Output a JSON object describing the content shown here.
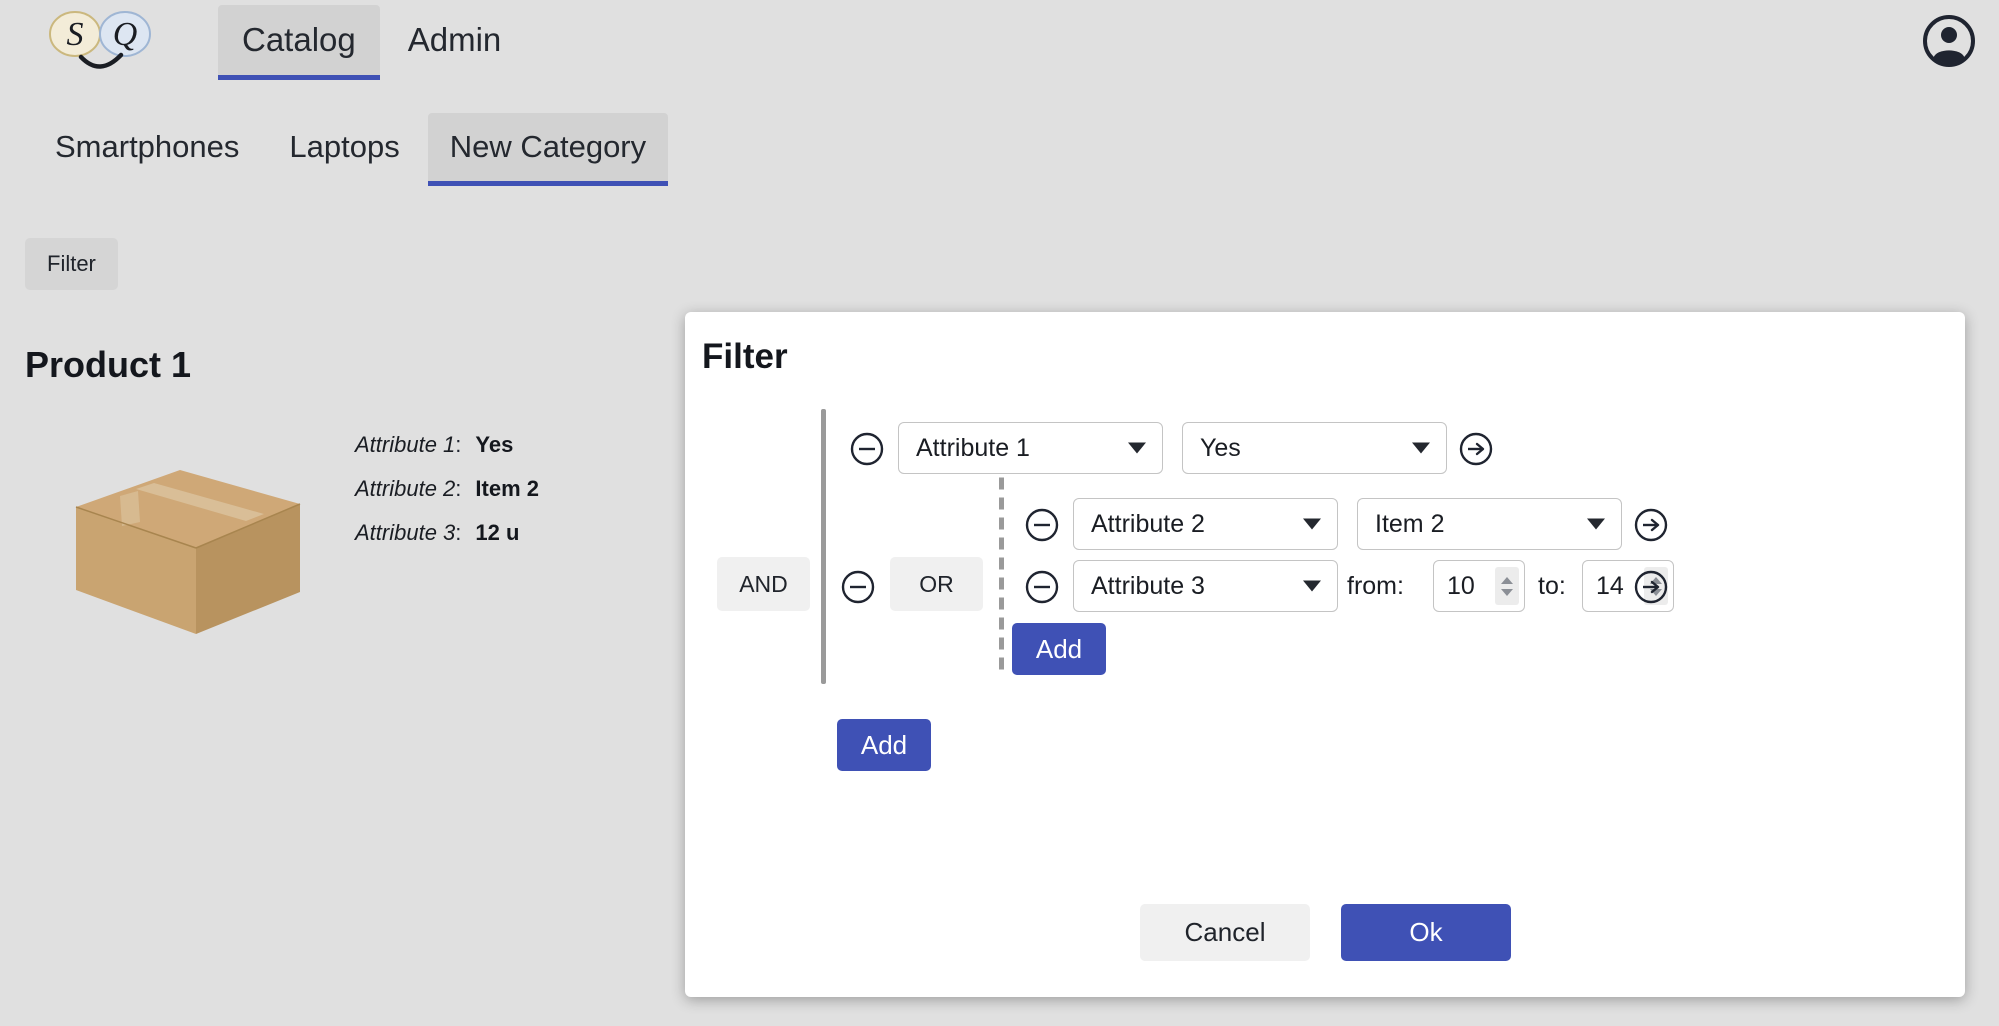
{
  "app": {
    "logo_letters": [
      "S",
      "Q"
    ],
    "accent_color": "#3f51b5",
    "background_color": "#e0e0e0",
    "dialog_background": "#ffffff"
  },
  "header": {
    "tabs": [
      {
        "label": "Catalog",
        "active": true
      },
      {
        "label": "Admin",
        "active": false
      }
    ],
    "account_icon": "account-circle-icon"
  },
  "category_tabs": [
    {
      "label": "Smartphones",
      "active": false
    },
    {
      "label": "Laptops",
      "active": false
    },
    {
      "label": "New Category",
      "active": true
    }
  ],
  "catalog": {
    "filter_button_label": "Filter",
    "product": {
      "title": "Product 1",
      "image": "cardboard-box",
      "attributes": [
        {
          "label": "Attribute 1",
          "separator": ":",
          "value": "Yes"
        },
        {
          "label": "Attribute 2",
          "separator": ":",
          "value": "Item 2"
        },
        {
          "label": "Attribute 3",
          "separator": ":",
          "value": "12 u"
        }
      ]
    }
  },
  "dialog": {
    "title": "Filter",
    "outer_group": {
      "operator_label": "AND",
      "add_label": "Add",
      "remove_icon": "minus-circle-icon"
    },
    "inner_group": {
      "operator_label": "OR",
      "add_label": "Add",
      "remove_icon": "minus-circle-icon"
    },
    "conditions": [
      {
        "attribute": "Attribute 1",
        "value_type": "select",
        "value": "Yes",
        "remove_icon": "minus-circle-icon",
        "goto_icon": "arrow-right-circle-icon"
      },
      {
        "attribute": "Attribute 2",
        "value_type": "select",
        "value": "Item 2",
        "remove_icon": "minus-circle-icon",
        "goto_icon": "arrow-right-circle-icon"
      },
      {
        "attribute": "Attribute 3",
        "value_type": "range",
        "from_label": "from:",
        "from_value": "10",
        "to_label": "to:",
        "to_value": "14",
        "remove_icon": "minus-circle-icon",
        "goto_icon": "arrow-right-circle-icon"
      }
    ],
    "footer": {
      "cancel_label": "Cancel",
      "ok_label": "Ok"
    }
  }
}
